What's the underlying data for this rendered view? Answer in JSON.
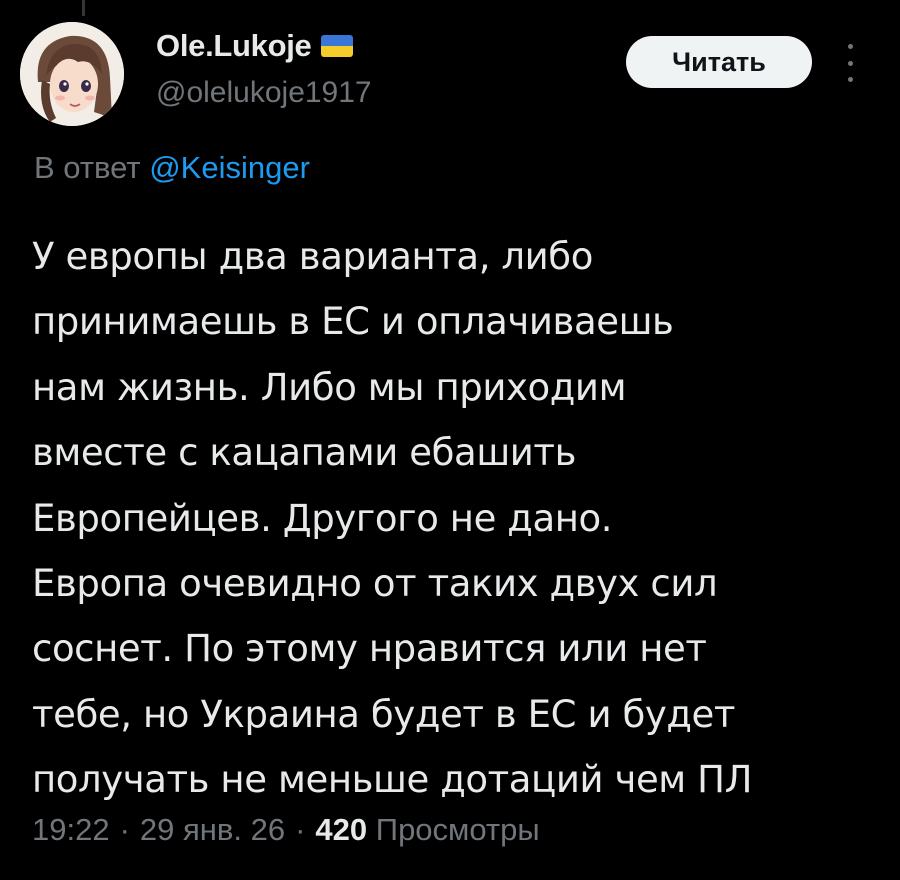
{
  "author": {
    "display_name": "Ole.Lukoje",
    "flag": "ukraine-flag-icon",
    "handle": "@olelukoje1917",
    "avatar": "anime-character-avatar"
  },
  "actions": {
    "follow_label": "Читать",
    "more_icon": "more-vertical-icon"
  },
  "reply": {
    "prefix": "В ответ",
    "mention": "@Keisinger"
  },
  "tweet": {
    "lines": [
      "У европы два варианта, либо",
      "принимаешь в ЕС и оплачиваешь",
      "нам жизнь. Либо мы приходим",
      "вместе с кацапами ебашить",
      "Европейцев. Другого не дано.",
      "Европа очевидно от таких двух сил",
      "соснет. По этому нравится или нет",
      "тебе, но Украина будет в ЕС и будет",
      "получать не меньше дотаций чем ПЛ"
    ]
  },
  "meta": {
    "time": "19:22",
    "date": "29 янв. 26",
    "views_count": "420",
    "views_label": "Просмотры",
    "separator": "·"
  },
  "colors": {
    "background": "#000000",
    "text": "#e7e9ea",
    "secondary": "#71767b",
    "link": "#1d9bf0",
    "button_bg": "#eff3f4"
  }
}
